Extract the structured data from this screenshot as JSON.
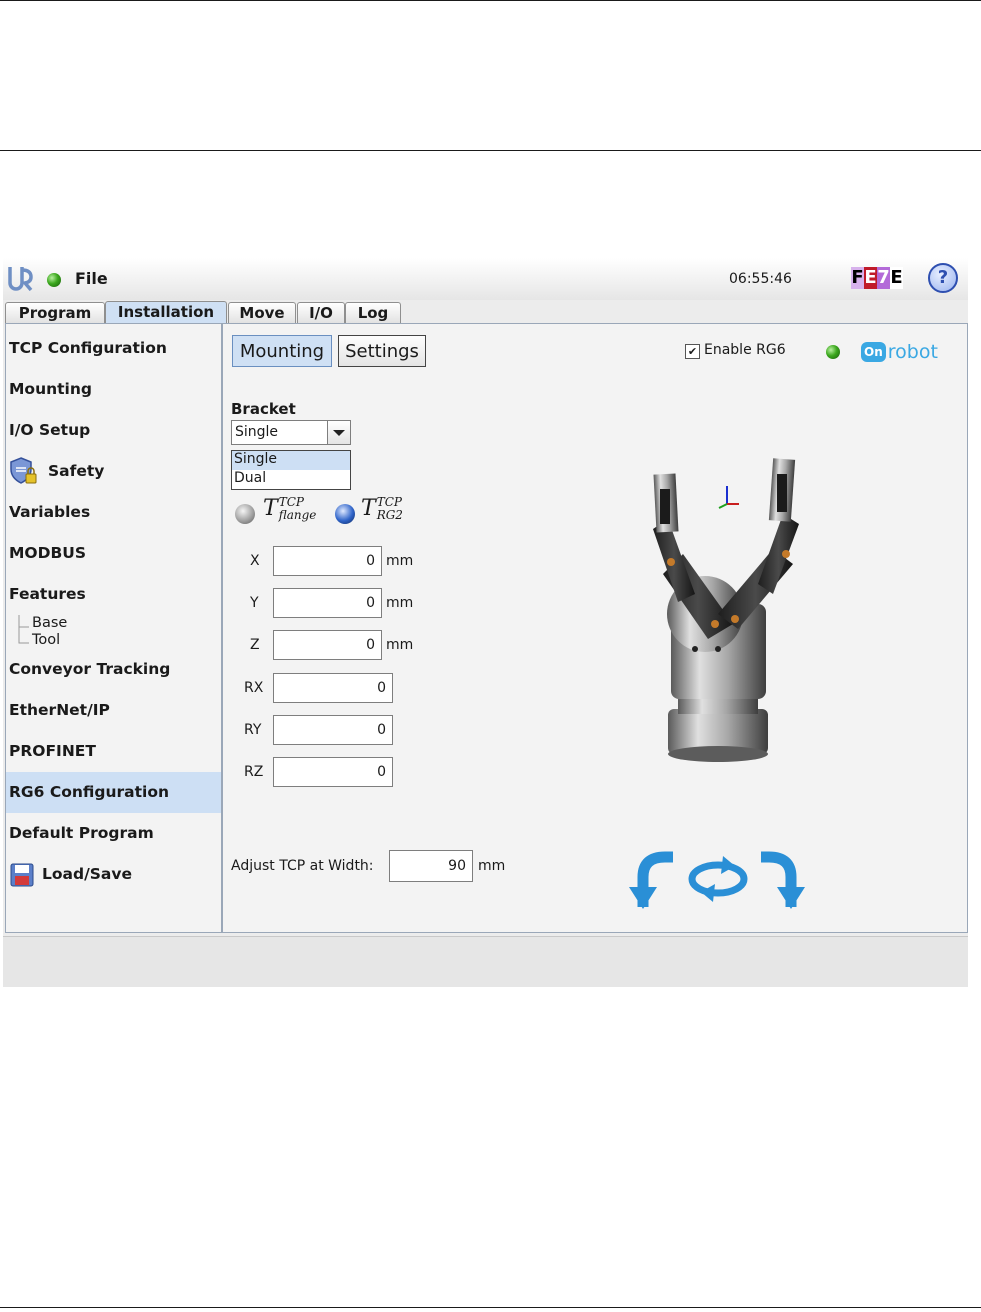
{
  "header": {
    "file_label": "File",
    "clock": "06:55:46",
    "badge_letters": [
      "F",
      "E",
      "7",
      "E"
    ],
    "help_label": "?"
  },
  "tabs": [
    {
      "label": "Program",
      "active": false
    },
    {
      "label": "Installation",
      "active": true
    },
    {
      "label": "Move",
      "active": false
    },
    {
      "label": "I/O",
      "active": false
    },
    {
      "label": "Log",
      "active": false
    }
  ],
  "sidebar": {
    "items": [
      {
        "label": "TCP Configuration"
      },
      {
        "label": "Mounting"
      },
      {
        "label": "I/O Setup"
      },
      {
        "label": "Safety"
      },
      {
        "label": "Variables"
      },
      {
        "label": "MODBUS"
      },
      {
        "label": "Features"
      },
      {
        "label": "Conveyor Tracking"
      },
      {
        "label": "EtherNet/IP"
      },
      {
        "label": "PROFINET"
      },
      {
        "label": "RG6 Configuration",
        "selected": true
      },
      {
        "label": "Default Program"
      },
      {
        "label": "Load/Save"
      }
    ],
    "features_children": [
      "Base",
      "Tool"
    ]
  },
  "main": {
    "mounting_button": "Mounting",
    "settings_button": "Settings",
    "enable_label": "Enable RG6",
    "enable_checked": true,
    "brand": "robot",
    "brand_mark": "On",
    "bracket": {
      "label": "Bracket",
      "selected": "Single",
      "options": [
        "Single",
        "Dual"
      ]
    },
    "tcp_options": [
      {
        "base": "T",
        "sup": "TCP",
        "sub": "flange",
        "selected": false
      },
      {
        "base": "T",
        "sup": "TCP",
        "sub": "RG2",
        "selected": true
      }
    ],
    "fields": [
      {
        "label": "X",
        "value": "0",
        "unit": "mm"
      },
      {
        "label": "Y",
        "value": "0",
        "unit": "mm"
      },
      {
        "label": "Z",
        "value": "0",
        "unit": "mm"
      },
      {
        "label": "RX",
        "value": "0",
        "unit": ""
      },
      {
        "label": "RY",
        "value": "0",
        "unit": ""
      },
      {
        "label": "RZ",
        "value": "0",
        "unit": ""
      }
    ],
    "adjust": {
      "label": "Adjust TCP at Width:",
      "value": "90",
      "unit": "mm"
    }
  },
  "colors": {
    "selection": "#cddff4",
    "rotate_arrows": "#2a8fd6",
    "badge_bg": [
      "#ffffff",
      "#c01a2a",
      "#b36ad8",
      "#ffffff"
    ]
  }
}
